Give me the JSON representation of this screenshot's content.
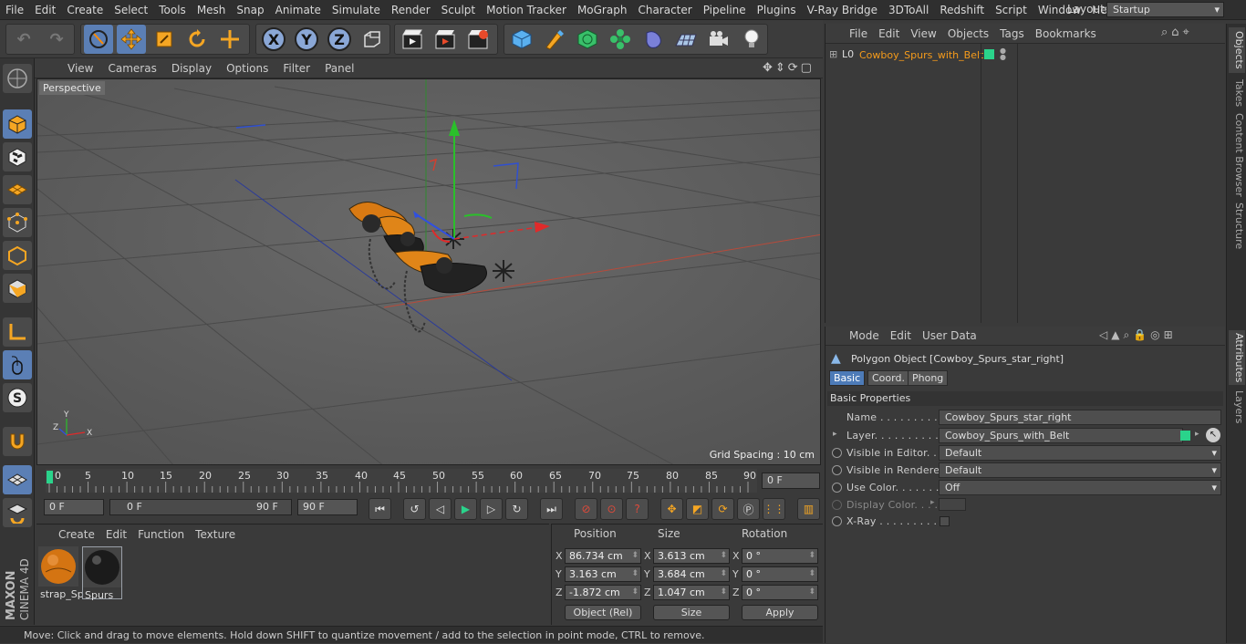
{
  "menubar": {
    "items": [
      "File",
      "Edit",
      "Create",
      "Select",
      "Tools",
      "Mesh",
      "Snap",
      "Animate",
      "Simulate",
      "Render",
      "Sculpt",
      "Motion Tracker",
      "MoGraph",
      "Character",
      "Pipeline",
      "Plugins",
      "V-Ray Bridge",
      "3DToAll",
      "Redshift",
      "Script",
      "Window",
      "Help"
    ],
    "layout_label": "Layout:",
    "layout_value": "Startup"
  },
  "toolbar": {
    "axis_x": "X",
    "axis_y": "Y",
    "axis_z": "Z"
  },
  "viewport": {
    "menu": [
      "View",
      "Cameras",
      "Display",
      "Options",
      "Filter",
      "Panel"
    ],
    "label": "Perspective",
    "grid_spacing": "Grid Spacing : 10 cm",
    "axis_y": "Y",
    "axis_x": "X",
    "axis_z": "Z"
  },
  "timeline": {
    "ticks": [
      "0",
      "5",
      "10",
      "15",
      "20",
      "25",
      "30",
      "35",
      "40",
      "45",
      "50",
      "55",
      "60",
      "65",
      "70",
      "75",
      "80",
      "85",
      "90"
    ],
    "current_frame": "0 F"
  },
  "transport": {
    "start_frame": "0 F",
    "range_start": "0 F",
    "range_end": "90 F",
    "end_frame": "90 F"
  },
  "materials": {
    "menu": [
      "Create",
      "Edit",
      "Function",
      "Texture"
    ],
    "items": [
      {
        "name": "strap_Sp"
      },
      {
        "name": "Spurs"
      }
    ]
  },
  "coords": {
    "headers": {
      "position": "Position",
      "size": "Size",
      "rotation": "Rotation"
    },
    "rows": [
      {
        "axis": "X",
        "pos": "86.734 cm",
        "size": "3.613 cm",
        "rot": "0 °"
      },
      {
        "axis": "Y",
        "pos": "3.163 cm",
        "size": "3.684 cm",
        "rot": "0 °"
      },
      {
        "axis": "Z",
        "pos": "-1.872 cm",
        "size": "1.047 cm",
        "rot": "0 °"
      }
    ],
    "mode_select": "Object (Rel)",
    "size_select": "Size",
    "apply": "Apply"
  },
  "status": "Move: Click and drag to move elements. Hold down SHIFT to quantize movement / add to the selection in point mode, CTRL to remove.",
  "object_manager": {
    "menu": [
      "File",
      "Edit",
      "View",
      "Objects",
      "Tags",
      "Bookmarks"
    ],
    "object_name": "Cowboy_Spurs_with_Belt"
  },
  "attributes": {
    "menu": [
      "Mode",
      "Edit",
      "User Data"
    ],
    "title": "Polygon Object [Cowboy_Spurs_star_right]",
    "tabs": [
      "Basic",
      "Coord.",
      "Phong"
    ],
    "section": "Basic Properties",
    "fields": {
      "name_label": "Name . . . . . . . . . . . .",
      "name_value": "Cowboy_Spurs_star_right",
      "layer_label": "Layer. . . . . . . . . . . .",
      "layer_value": "Cowboy_Spurs_with_Belt",
      "vis_editor_label": "Visible in Editor. . .",
      "vis_editor_value": "Default",
      "vis_render_label": "Visible in Renderer",
      "vis_render_value": "Default",
      "use_color_label": "Use Color. . . . . . . .",
      "use_color_value": "Off",
      "display_color_label": "Display Color. . . .",
      "xray_label": "X-Ray . . . . . . . . . . ."
    }
  },
  "side_tabs": [
    "Objects",
    "Takes",
    "Content Browser",
    "Structure",
    "Attributes",
    "Layers"
  ],
  "brand": {
    "maxon": "MAXON",
    "cinema": "CINEMA 4D"
  },
  "colors": {
    "accent": "#f59b1b",
    "selected_tab": "#4d7bb8",
    "layer_green": "#2ad38b"
  }
}
